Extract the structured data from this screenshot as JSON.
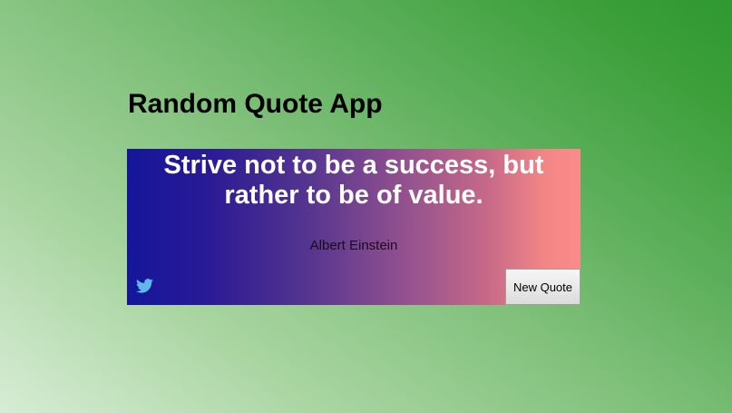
{
  "app": {
    "title": "Random Quote App"
  },
  "quote": {
    "text": "Strive not to be a success, but rather to be of value.",
    "author": "Albert Einstein"
  },
  "actions": {
    "new_quote_label": "New Quote",
    "tweet_icon": "twitter-icon"
  },
  "colors": {
    "card_gradient_start": "#14169a",
    "card_gradient_end": "#fb8a8a",
    "twitter_icon": "#5fb8ec"
  }
}
